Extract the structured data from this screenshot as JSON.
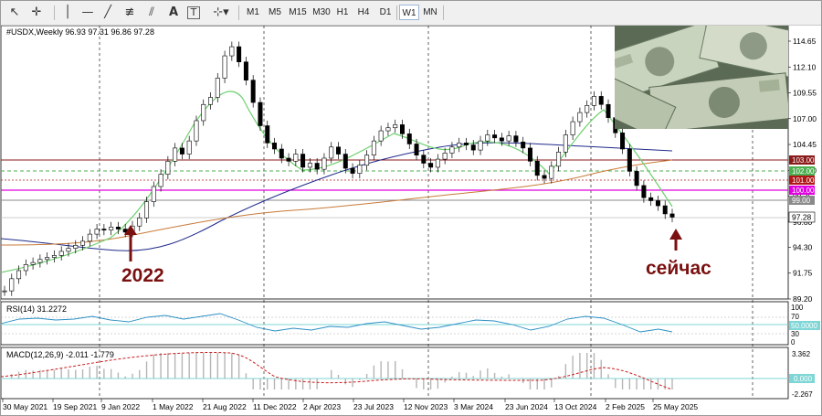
{
  "toolbar": {
    "timeframes": [
      "M1",
      "M5",
      "M15",
      "M30",
      "H1",
      "H4",
      "D1",
      "W1",
      "MN"
    ],
    "active_timeframe": "W1"
  },
  "main_chart": {
    "symbol_info": "#USDX,Weekly  96.93 97.31 96.86 97.28",
    "price_ticks": [
      "114.65",
      "112.10",
      "109.55",
      "107.00",
      "104.45",
      "101.90",
      "99.35",
      "96.80",
      "94.30",
      "91.75",
      "89.20"
    ],
    "level_labels": [
      {
        "price": "103.00",
        "color": "#8b1a1a"
      },
      {
        "price": "102.00",
        "color": "#4caf50"
      },
      {
        "price": "101.00",
        "color": "#b01818"
      },
      {
        "price": "100.00",
        "color": "#e000e0"
      },
      {
        "price": "99.00",
        "color": "#8a8a8a"
      }
    ],
    "current_price": "97.28",
    "annotation_2022": "2022",
    "annotation_now": "сейчас",
    "annotation_color": "#7a1010"
  },
  "rsi_panel": {
    "label": "RSI(14) 31.2272",
    "ticks": [
      "100",
      "70",
      "30",
      "0"
    ],
    "badge": "50.0000"
  },
  "macd_panel": {
    "label": "MACD(12,26,9) -2.011 -1.779",
    "ticks": [
      "3.362",
      "-2.267"
    ],
    "badge": "0.000"
  },
  "time_axis": [
    "30 May 2021",
    "19 Sep 2021",
    "9 Jan 2022",
    "1 May 2022",
    "21 Aug 2022",
    "11 Dec 2022",
    "2 Apr 2023",
    "23 Jul 2023",
    "12 Nov 2023",
    "3 Mar 2024",
    "23 Jun 2024",
    "13 Oct 2024",
    "2 Feb 2025",
    "25 May 2025"
  ],
  "chart_data": {
    "type": "candlestick",
    "price_series": [
      90.0,
      91.2,
      92.0,
      92.6,
      92.8,
      93.1,
      93.3,
      93.5,
      93.9,
      94.2,
      94.5,
      94.9,
      95.6,
      96.1,
      96.0,
      96.3,
      96.1,
      95.8,
      96.4,
      97.2,
      98.8,
      100.3,
      101.5,
      102.8,
      104.1,
      103.5,
      104.8,
      106.8,
      108.4,
      109.1,
      111.0,
      113.2,
      114.1,
      112.6,
      110.8,
      108.6,
      106.3,
      104.6,
      104.0,
      103.1,
      102.8,
      103.5,
      102.2,
      102.6,
      102.0,
      103.1,
      104.2,
      103.5,
      102.1,
      101.6,
      102.4,
      103.4,
      104.8,
      105.8,
      106.1,
      106.4,
      105.5,
      104.5,
      103.4,
      102.6,
      102.2,
      103.0,
      103.6,
      104.2,
      104.6,
      104.4,
      103.9,
      104.8,
      105.4,
      105.1,
      104.8,
      105.3,
      104.7,
      104.1,
      102.8,
      101.4,
      101.1,
      102.3,
      103.7,
      105.4,
      106.7,
      107.6,
      108.3,
      109.2,
      108.4,
      107.1,
      105.6,
      104.0,
      101.8,
      100.4,
      99.2,
      98.9,
      98.4,
      97.6,
      97.28
    ]
  }
}
